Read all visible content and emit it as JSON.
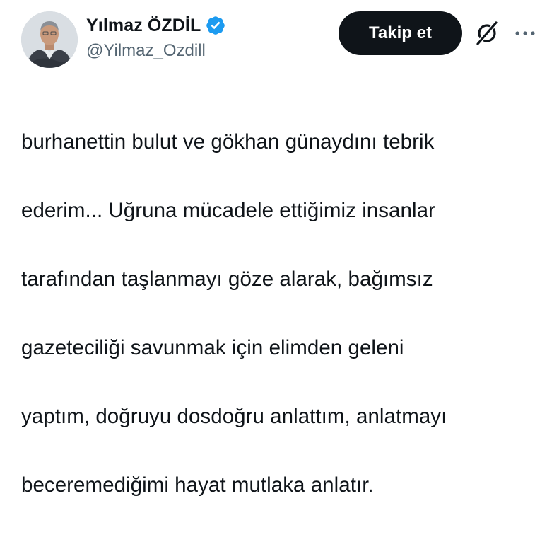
{
  "author": {
    "display_name": "Yılmaz ÖZDİL",
    "handle": "@Yilmaz_Ozdill",
    "verified": true,
    "verified_color": "#1d9bf0",
    "avatar_icon": "user-avatar"
  },
  "actions": {
    "follow_label": "Takip et",
    "grok_icon": "grok-icon",
    "more_icon": "more-horizontal-icon"
  },
  "tweet": {
    "text_lines": [
      "burhanettin bulut ve gökhan günaydını tebrik",
      "ederim... Uğruna mücadele ettiğimiz insanlar",
      "tarafından taşlanmayı göze alarak, bağımsız",
      "gazeteciliği savunmak için elimden geleni",
      "yaptım, doğruyu dosdoğru anlattım, anlatmayı",
      "beceremediğimi hayat mutlaka anlatır."
    ]
  },
  "colors": {
    "text_primary": "#0f1419",
    "text_secondary": "#536471",
    "button_bg": "#0f1419",
    "button_text": "#ffffff"
  }
}
